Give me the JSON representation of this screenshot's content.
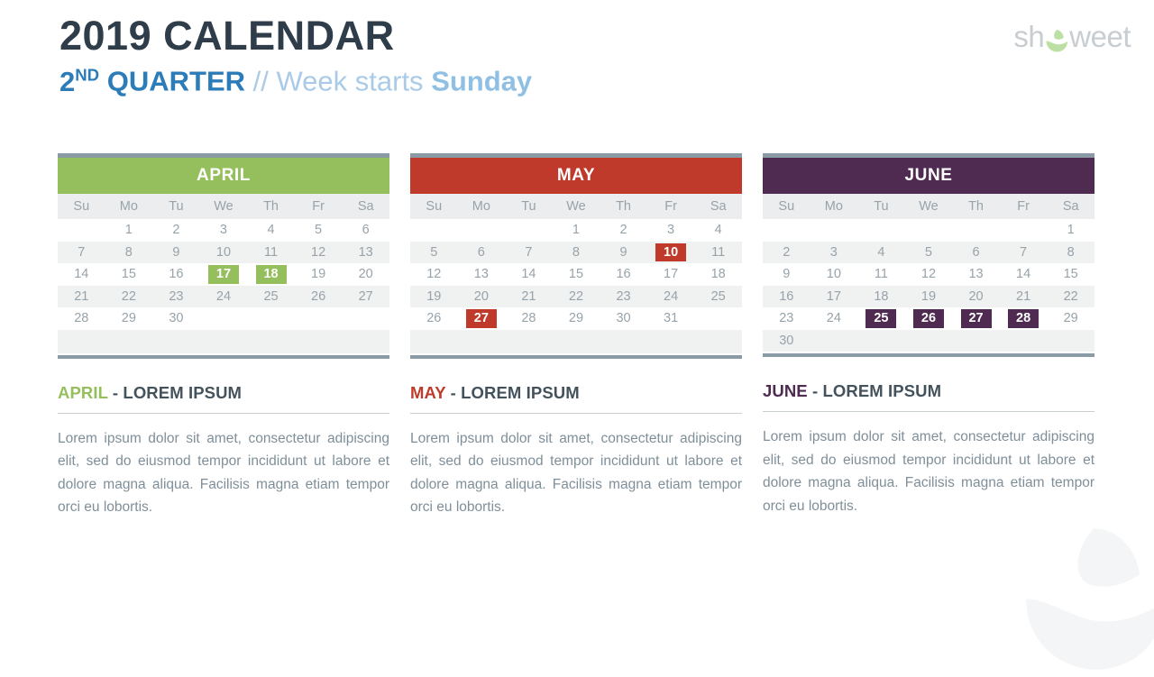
{
  "header": {
    "title": "2019 CALENDAR",
    "subtitle_quarter_number": "2",
    "subtitle_quarter_ordinal": "ND",
    "subtitle_quarter_word": "QUARTER",
    "subtitle_separator": "// Week starts",
    "subtitle_weekstart": "Sunday"
  },
  "logo": {
    "text_before": "sh",
    "text_after": "weet",
    "glyph": "showeet-circle-icon",
    "color": "#c7cdd1",
    "glyph_color": "#bcdfa4"
  },
  "weekdays": [
    "Su",
    "Mo",
    "Tu",
    "We",
    "Th",
    "Fr",
    "Sa"
  ],
  "months": [
    {
      "name": "APRIL",
      "color": "#95bf5c",
      "weeks": [
        [
          "",
          "1",
          "2",
          "3",
          "4",
          "5",
          "6"
        ],
        [
          "7",
          "8",
          "9",
          "10",
          "11",
          "12",
          "13"
        ],
        [
          "14",
          "15",
          "16",
          "17",
          "18",
          "19",
          "20"
        ],
        [
          "21",
          "22",
          "23",
          "24",
          "25",
          "26",
          "27"
        ],
        [
          "28",
          "29",
          "30",
          "",
          "",
          "",
          ""
        ],
        [
          "",
          "",
          "",
          "",
          "",
          "",
          ""
        ]
      ],
      "highlights": [
        "17",
        "18"
      ],
      "caption_month": "APRIL",
      "caption_rest": " - LOREM IPSUM",
      "body": "Lorem ipsum dolor sit amet, consectetur adipiscing elit, sed do eiusmod tempor incididunt ut labore et dolore magna aliqua. Facilisis magna etiam tempor orci eu lobortis."
    },
    {
      "name": "MAY",
      "color": "#c03a2b",
      "weeks": [
        [
          "",
          "",
          "",
          "1",
          "2",
          "3",
          "4"
        ],
        [
          "5",
          "6",
          "7",
          "8",
          "9",
          "10",
          "11"
        ],
        [
          "12",
          "13",
          "14",
          "15",
          "16",
          "17",
          "18"
        ],
        [
          "19",
          "20",
          "21",
          "22",
          "23",
          "24",
          "25"
        ],
        [
          "26",
          "27",
          "28",
          "29",
          "30",
          "31",
          ""
        ],
        [
          "",
          "",
          "",
          "",
          "",
          "",
          ""
        ]
      ],
      "highlights": [
        "10",
        "27"
      ],
      "caption_month": "MAY",
      "caption_rest": " - LOREM IPSUM",
      "body": "Lorem ipsum dolor sit amet, consectetur adipiscing elit, sed do eiusmod tempor incididunt ut labore et dolore magna aliqua. Facilisis magna etiam tempor orci eu lobortis."
    },
    {
      "name": "JUNE",
      "color": "#4f2a51",
      "weeks": [
        [
          "",
          "",
          "",
          "",
          "",
          "",
          "1"
        ],
        [
          "2",
          "3",
          "4",
          "5",
          "6",
          "7",
          "8"
        ],
        [
          "9",
          "10",
          "11",
          "12",
          "13",
          "14",
          "15"
        ],
        [
          "16",
          "17",
          "18",
          "19",
          "20",
          "21",
          "22"
        ],
        [
          "23",
          "24",
          "25",
          "26",
          "27",
          "28",
          "29"
        ],
        [
          "30",
          "",
          "",
          "",
          "",
          "",
          ""
        ]
      ],
      "highlights": [
        "25",
        "26",
        "27",
        "28"
      ],
      "caption_month": "JUNE",
      "caption_rest": " - LOREM IPSUM",
      "body": "Lorem ipsum dolor sit amet, consectetur adipiscing elit, sed do eiusmod tempor incididunt ut labore et dolore magna aliqua. Facilisis magna etiam tempor orci eu lobortis."
    }
  ]
}
